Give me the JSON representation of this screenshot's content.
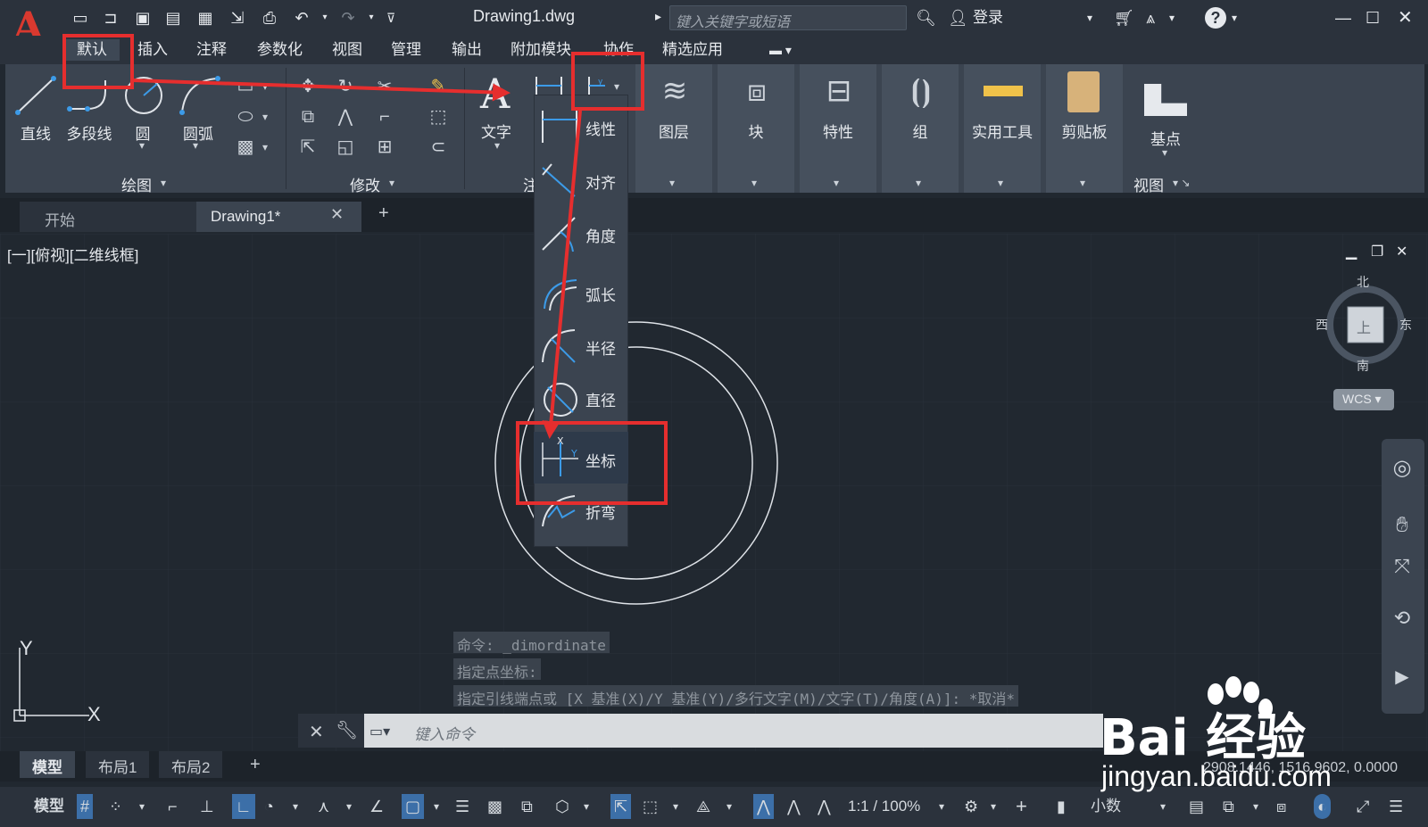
{
  "title_bar": {
    "doc_title": "Drawing1.dwg",
    "search_placeholder": "键入关键字或短语",
    "login": "登录"
  },
  "menu_tabs": [
    "默认",
    "插入",
    "注释",
    "参数化",
    "视图",
    "管理",
    "输出",
    "附加模块",
    "协作",
    "精选应用"
  ],
  "ribbon": {
    "draw": {
      "tools": [
        "直线",
        "多段线",
        "圆",
        "圆弧"
      ],
      "panel_title": "绘图"
    },
    "modify": {
      "panel_title": "修改"
    },
    "annotation": {
      "text_label": "文字",
      "panel_title_partial": "注"
    },
    "buttons": [
      "图层",
      "块",
      "特性",
      "组",
      "实用工具",
      "剪贴板",
      "基点"
    ],
    "view_panel_title": "视图"
  },
  "dim_dropdown": {
    "items": [
      "线性",
      "对齐",
      "角度",
      "弧长",
      "半径",
      "直径",
      "坐标",
      "折弯"
    ]
  },
  "doc_tabs": {
    "start": "开始",
    "drawing": "Drawing1*"
  },
  "viewport_label": "[一][俯视][二维线框]",
  "viewcube": {
    "north": "北",
    "south": "南",
    "east": "东",
    "west": "西",
    "face": "上",
    "wcs": "WCS"
  },
  "command": {
    "history": [
      "命令: _dimordinate",
      "指定点坐标:",
      "指定引线端点或 [X 基准(X)/Y 基准(Y)/多行文字(M)/文字(T)/角度(A)]: *取消*"
    ],
    "input_placeholder": "键入命令"
  },
  "ucs": {
    "x": "X",
    "y": "Y"
  },
  "layout_tabs": [
    "模型",
    "布局1",
    "布局2"
  ],
  "coordinates": "2908.1446, 1516.9602, 0.0000",
  "status_bar": {
    "model": "模型",
    "scale": "1:1 / 100%",
    "units": "小数"
  },
  "watermark": {
    "brand": "Bai 经验",
    "url": "jingyan.baidu.com"
  },
  "colors": {
    "highlight": "#e62e2e",
    "accent_blue": "#3c9be8"
  }
}
